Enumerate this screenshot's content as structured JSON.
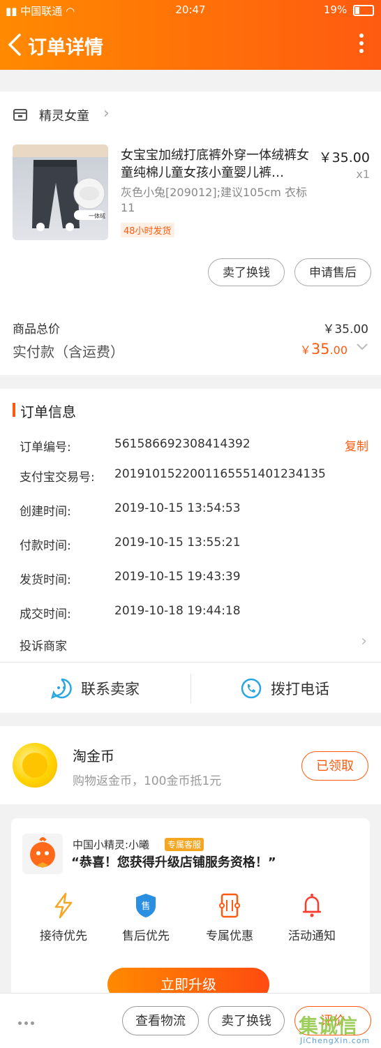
{
  "status_bar": {
    "carrier": "中国联通",
    "time": "20:47",
    "battery": "19%"
  },
  "nav": {
    "title": "订单详情"
  },
  "shop": {
    "name": "精灵女童"
  },
  "product": {
    "title": "女宝宝加绒打底裤外穿一体绒裤女童纯棉儿童女孩小童婴儿裤…",
    "price": "￥35.00",
    "qty": "x1",
    "sku": "灰色小兔[209012];建议105cm 衣标11",
    "tag": "48小时发货",
    "image_caption": "一体绒",
    "buttons": [
      "卖了换钱",
      "申请售后"
    ]
  },
  "summary": {
    "total_label": "商品总价",
    "total_value": "￥35.00",
    "paid_label": "实付款（含运费）",
    "paid_currency": "￥",
    "paid_int": "35",
    "paid_dec": ".00"
  },
  "order_info": {
    "title": "订单信息",
    "copy_label": "复制",
    "rows": [
      {
        "label": "订单编号:",
        "value": "561586692308414392"
      },
      {
        "label": "支付宝交易号:",
        "value": "2019101522001165551401234135"
      },
      {
        "label": "创建时间:",
        "value": "2019-10-15 13:54:53"
      },
      {
        "label": "付款时间:",
        "value": "2019-10-15 13:55:21"
      },
      {
        "label": "发货时间:",
        "value": "2019-10-15 19:43:39"
      },
      {
        "label": "成交时间:",
        "value": "2019-10-18 19:44:18"
      }
    ],
    "complain": "投诉商家"
  },
  "contact": {
    "seller": "联系卖家",
    "phone": "拨打电话"
  },
  "coins": {
    "title": "淘金币",
    "subtitle": "购物返金币，100金币抵1元",
    "button": "已领取"
  },
  "vip": {
    "name": "中国小精灵:小曦",
    "badge": "专属客服",
    "message": "“恭喜！您获得升级店铺服务资格！”",
    "perks": [
      "接待优先",
      "售后优先",
      "专属优惠",
      "活动通知"
    ],
    "perk_icon_char": "售",
    "upgrade": "立即升级"
  },
  "bottom_bar": {
    "buttons": [
      "查看物流",
      "卖了换钱",
      "评价"
    ]
  },
  "watermark": {
    "big": "集诚信",
    "small": "JiChengXin.com"
  },
  "colors": {
    "accent": "#ff5a10",
    "brand_gradient_start": "#ff8a00"
  }
}
